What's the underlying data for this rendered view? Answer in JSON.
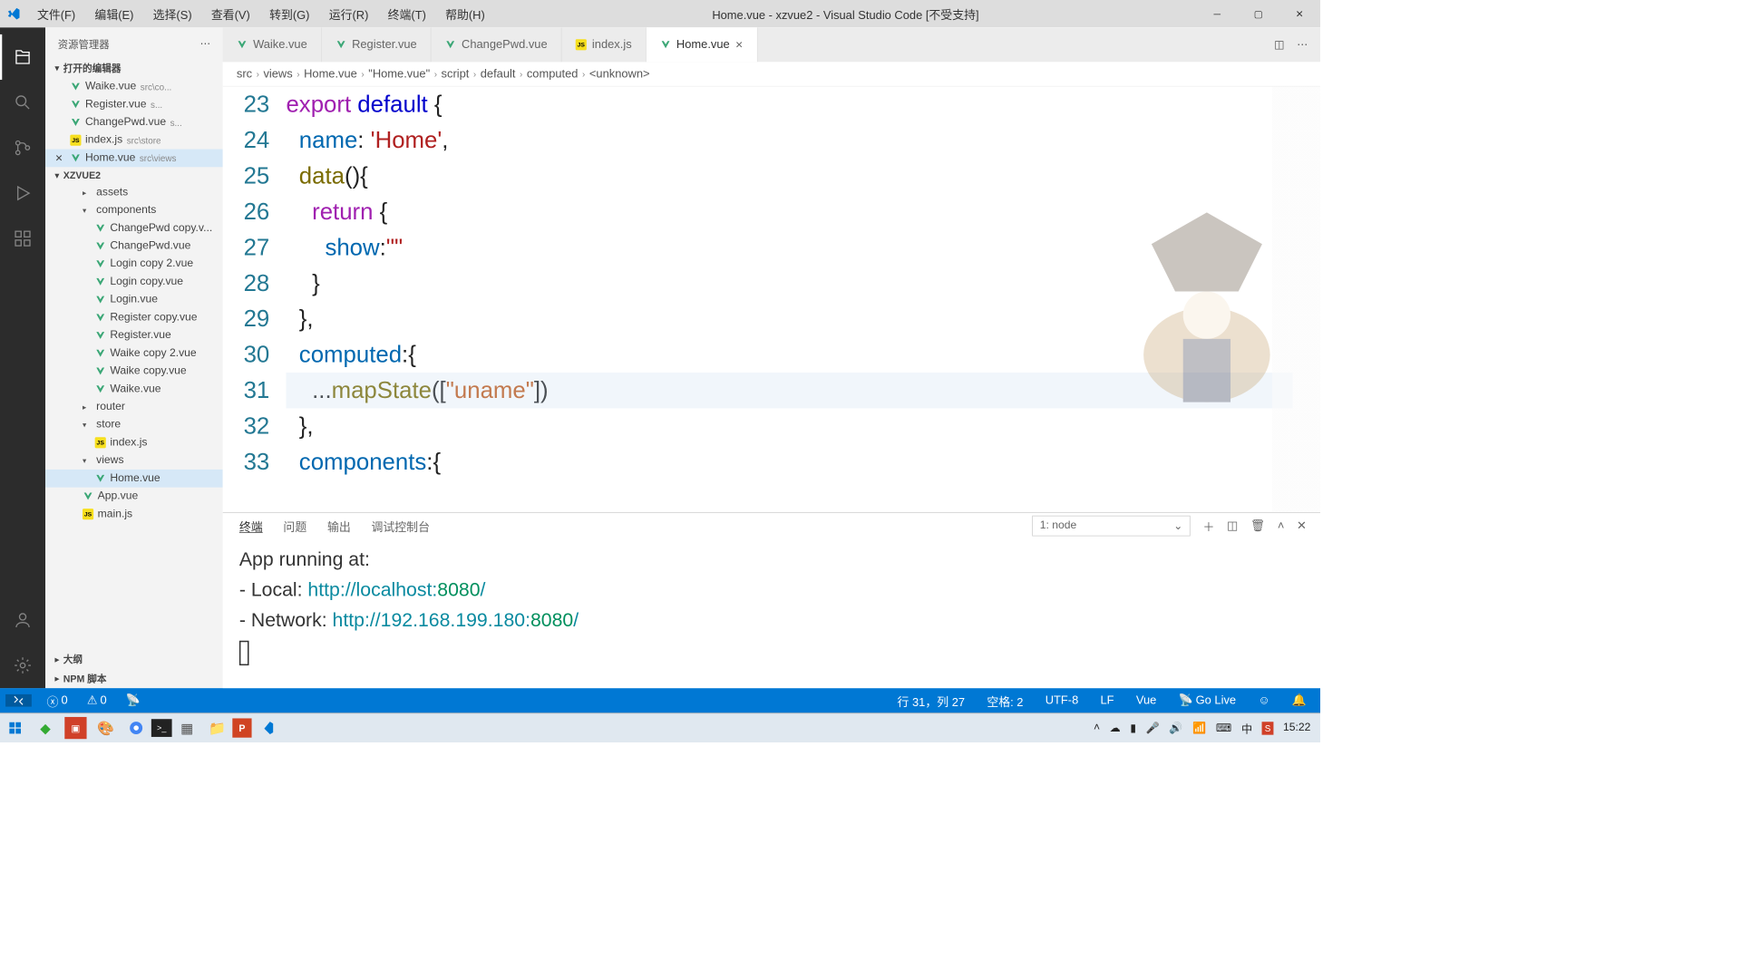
{
  "titlebar": {
    "menus": [
      "文件(F)",
      "编辑(E)",
      "选择(S)",
      "查看(V)",
      "转到(G)",
      "运行(R)",
      "终端(T)",
      "帮助(H)"
    ],
    "title": "Home.vue - xzvue2 - Visual Studio Code [不受支持]"
  },
  "sidebar": {
    "header": "资源管理器",
    "openEditors": "打开的编辑器",
    "openFiles": [
      {
        "name": "Waike.vue",
        "path": "src\\co...",
        "icon": "vue"
      },
      {
        "name": "Register.vue",
        "path": "s...",
        "icon": "vue"
      },
      {
        "name": "ChangePwd.vue",
        "path": "s...",
        "icon": "vue"
      },
      {
        "name": "index.js",
        "path": "src\\store",
        "icon": "js"
      },
      {
        "name": "Home.vue",
        "path": "src\\views",
        "icon": "vue",
        "active": true
      }
    ],
    "project": "XZVUE2",
    "tree": [
      {
        "type": "folder",
        "name": "assets",
        "open": false,
        "indent": 2
      },
      {
        "type": "folder",
        "name": "components",
        "open": true,
        "indent": 2
      },
      {
        "type": "file",
        "name": "ChangePwd copy.v...",
        "icon": "vue",
        "indent": 3
      },
      {
        "type": "file",
        "name": "ChangePwd.vue",
        "icon": "vue",
        "indent": 3
      },
      {
        "type": "file",
        "name": "Login copy 2.vue",
        "icon": "vue",
        "indent": 3
      },
      {
        "type": "file",
        "name": "Login copy.vue",
        "icon": "vue",
        "indent": 3
      },
      {
        "type": "file",
        "name": "Login.vue",
        "icon": "vue",
        "indent": 3
      },
      {
        "type": "file",
        "name": "Register copy.vue",
        "icon": "vue",
        "indent": 3
      },
      {
        "type": "file",
        "name": "Register.vue",
        "icon": "vue",
        "indent": 3
      },
      {
        "type": "file",
        "name": "Waike copy 2.vue",
        "icon": "vue",
        "indent": 3
      },
      {
        "type": "file",
        "name": "Waike copy.vue",
        "icon": "vue",
        "indent": 3
      },
      {
        "type": "file",
        "name": "Waike.vue",
        "icon": "vue",
        "indent": 3
      },
      {
        "type": "folder",
        "name": "router",
        "open": false,
        "indent": 2
      },
      {
        "type": "folder",
        "name": "store",
        "open": true,
        "indent": 2
      },
      {
        "type": "file",
        "name": "index.js",
        "icon": "js",
        "indent": 3
      },
      {
        "type": "folder",
        "name": "views",
        "open": true,
        "indent": 2
      },
      {
        "type": "file",
        "name": "Home.vue",
        "icon": "vue",
        "indent": 3,
        "selected": true
      },
      {
        "type": "file",
        "name": "App.vue",
        "icon": "vue",
        "indent": 2
      },
      {
        "type": "file",
        "name": "main.js",
        "icon": "js",
        "indent": 2
      }
    ],
    "outline": "大纲",
    "npm": "NPM 脚本"
  },
  "tabs": [
    {
      "name": "Waike.vue",
      "icon": "vue"
    },
    {
      "name": "Register.vue",
      "icon": "vue"
    },
    {
      "name": "ChangePwd.vue",
      "icon": "vue"
    },
    {
      "name": "index.js",
      "icon": "js"
    },
    {
      "name": "Home.vue",
      "icon": "vue",
      "active": true
    }
  ],
  "breadcrumbs": [
    "src",
    "views",
    "Home.vue",
    "\"Home.vue\"",
    "script",
    "default",
    "computed",
    "<unknown>"
  ],
  "code": {
    "startLine": 23,
    "lines": [
      [
        {
          "c": "kw-export",
          "t": "export"
        },
        {
          "c": "plain",
          "t": " "
        },
        {
          "c": "kw-default",
          "t": "default"
        },
        {
          "c": "plain",
          "t": " "
        },
        {
          "c": "brace",
          "t": "{"
        }
      ],
      [
        {
          "c": "plain",
          "t": "  "
        },
        {
          "c": "ident",
          "t": "name"
        },
        {
          "c": "plain",
          "t": ": "
        },
        {
          "c": "str",
          "t": "'Home'"
        },
        {
          "c": "plain",
          "t": ","
        }
      ],
      [
        {
          "c": "plain",
          "t": "  "
        },
        {
          "c": "func",
          "t": "data"
        },
        {
          "c": "plain",
          "t": "(){"
        }
      ],
      [
        {
          "c": "plain",
          "t": "    "
        },
        {
          "c": "kw-return",
          "t": "return"
        },
        {
          "c": "plain",
          "t": " "
        },
        {
          "c": "brace",
          "t": "{"
        }
      ],
      [
        {
          "c": "plain",
          "t": "      "
        },
        {
          "c": "ident",
          "t": "show"
        },
        {
          "c": "plain",
          "t": ":"
        },
        {
          "c": "str",
          "t": "\"\""
        }
      ],
      [
        {
          "c": "plain",
          "t": "    "
        },
        {
          "c": "brace",
          "t": "}"
        }
      ],
      [
        {
          "c": "plain",
          "t": "  "
        },
        {
          "c": "brace",
          "t": "},"
        }
      ],
      [
        {
          "c": "plain",
          "t": "  "
        },
        {
          "c": "ident",
          "t": "computed"
        },
        {
          "c": "plain",
          "t": ":"
        },
        {
          "c": "brace",
          "t": "{"
        }
      ],
      [
        {
          "c": "plain",
          "t": "    ..."
        },
        {
          "c": "func",
          "t": "mapState"
        },
        {
          "c": "plain",
          "t": "(["
        },
        {
          "c": "str2",
          "t": "\"uname\""
        },
        {
          "c": "plain",
          "t": "])"
        }
      ],
      [
        {
          "c": "plain",
          "t": "  "
        },
        {
          "c": "brace",
          "t": "},"
        }
      ],
      [
        {
          "c": "plain",
          "t": "  "
        },
        {
          "c": "ident",
          "t": "components"
        },
        {
          "c": "plain",
          "t": ":"
        },
        {
          "c": "brace",
          "t": "{"
        }
      ]
    ],
    "highlightLine": 31
  },
  "terminal": {
    "tabs": [
      "终端",
      "问题",
      "输出",
      "调试控制台"
    ],
    "selector": "1: node",
    "line1": "App running at:",
    "local_label": "- Local:   ",
    "local_url": "http://localhost:",
    "local_port": "8080",
    "net_label": "- Network: ",
    "net_url": "http://192.168.199.180:",
    "net_port": "8080"
  },
  "statusbar": {
    "errors": "0",
    "warnings": "0",
    "pos": "行 31，列 27",
    "spaces": "空格: 2",
    "encoding": "UTF-8",
    "eol": "LF",
    "lang": "Vue",
    "golive": "Go Live"
  },
  "taskbar": {
    "time": "15:22"
  }
}
